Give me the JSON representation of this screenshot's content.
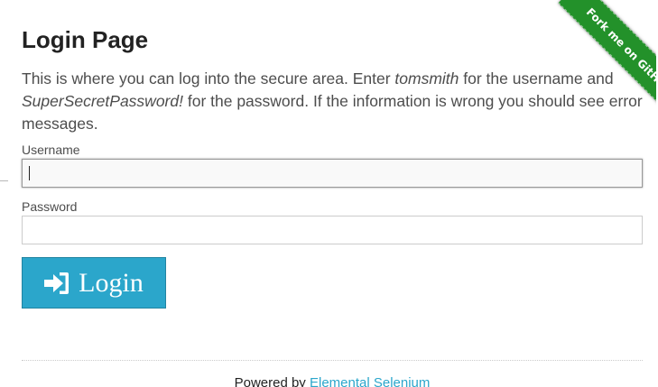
{
  "page": {
    "title": "Login Page",
    "intro": {
      "part1": "This is where you can log into the secure area. Enter ",
      "username_hint": "tomsmith",
      "part2": " for the username and ",
      "password_hint": "SuperSecretPassword!",
      "part3": " for the password. If the information is wrong you should see error messages."
    }
  },
  "form": {
    "username_label": "Username",
    "username_value": "",
    "password_label": "Password",
    "password_value": "",
    "login_label": "Login",
    "login_icon": "sign-in-icon"
  },
  "footer": {
    "prefix": "Powered by ",
    "link_text": "Elemental Selenium"
  },
  "ribbon": {
    "text": "Fork me on GitHub",
    "color": "#23912a"
  },
  "colors": {
    "accent": "#2ba6cb",
    "text": "#222222"
  }
}
